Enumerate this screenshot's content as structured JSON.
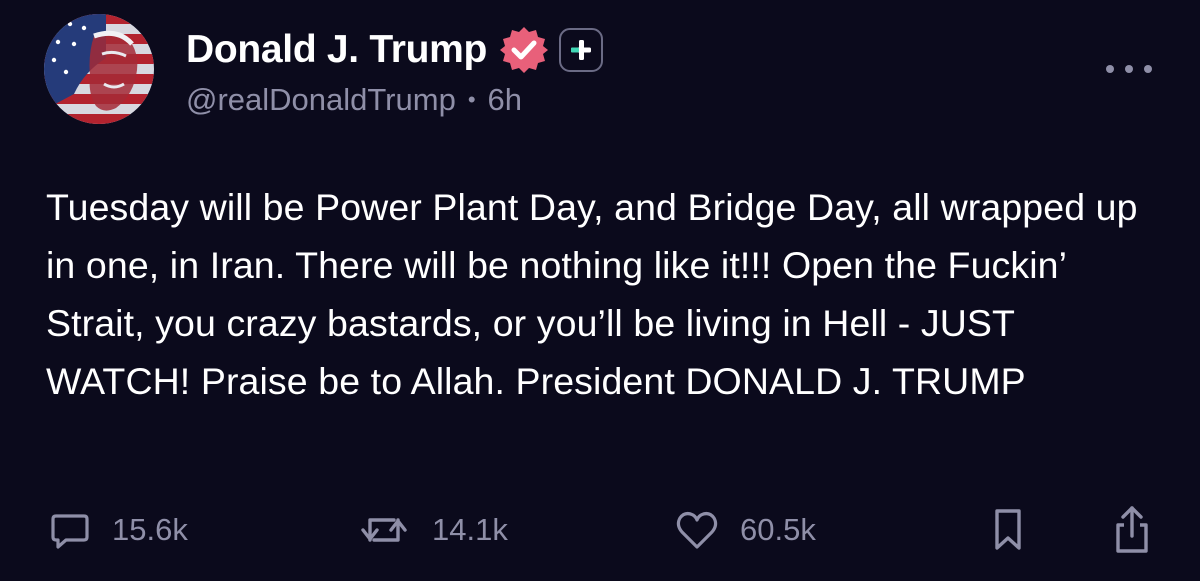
{
  "author": {
    "display_name": "Donald J. Trump",
    "handle": "@realDonaldTrump",
    "separator": "•",
    "time_ago": "6h",
    "avatar_icon": "avatar-flag-portrait-icon",
    "verified_icon": "verified-badge-icon",
    "subscribe_icon": "plus-badge-icon"
  },
  "post": {
    "text": "Tuesday will be Power Plant Day, and Bridge Day, all wrapped up in one, in Iran. There will be nothing like it!!! Open the Fuckin’ Strait, you crazy bastards, or you’ll be living in Hell - JUST WATCH! Praise be to Allah. President DONALD J. TRUMP"
  },
  "actions": {
    "replies": "15.6k",
    "reposts": "14.1k",
    "likes": "60.5k"
  },
  "colors": {
    "background": "#0b0a1c",
    "text": "#ffffff",
    "muted": "#8f8fa8",
    "verified_badge": "#e8607a",
    "plus_badge": "#3fd6b4"
  }
}
